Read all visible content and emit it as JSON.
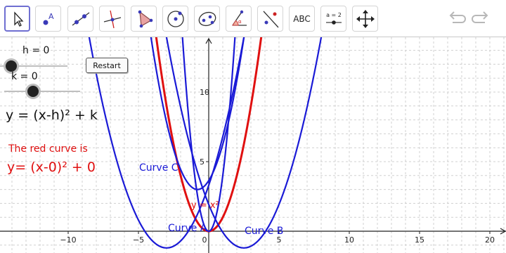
{
  "toolbar": {
    "tools": [
      {
        "name": "move-tool",
        "icon": "cursor-arrow-icon"
      },
      {
        "name": "point-tool",
        "icon": "point-a-icon"
      },
      {
        "name": "line-tool",
        "icon": "line-through-points-icon"
      },
      {
        "name": "perpendicular-line-tool",
        "icon": "perpendicular-line-icon"
      },
      {
        "name": "polygon-tool",
        "icon": "polygon-icon"
      },
      {
        "name": "circle-tool",
        "icon": "circle-center-point-icon"
      },
      {
        "name": "ellipse-tool",
        "icon": "ellipse-icon"
      },
      {
        "name": "angle-tool",
        "icon": "angle-icon"
      },
      {
        "name": "reflect-tool",
        "icon": "reflect-about-line-icon"
      },
      {
        "name": "text-tool",
        "icon": "text-icon",
        "label": "ABC"
      },
      {
        "name": "slider-tool",
        "icon": "slider-icon",
        "label": "a = 2"
      },
      {
        "name": "move-graphics-tool",
        "icon": "move-arrows-icon"
      }
    ],
    "undo_icon": "undo-icon",
    "redo_icon": "redo-icon"
  },
  "sliders": {
    "h": {
      "label": "h = 0",
      "value": 0
    },
    "k": {
      "label": "k = 0",
      "value": 0
    }
  },
  "restart_label": "Restart",
  "equation_text": "y = (x-h)² + k",
  "red_note": "The red curve is",
  "red_equation": "y= (x-0)² + 0",
  "curves": {
    "red_label": "y = x²",
    "curve_a": "Curve A",
    "curve_b": "Curve B",
    "curve_c": "Curve C"
  },
  "colors": {
    "red": "#e01010",
    "blue": "#1a1ad6",
    "grid": "#d0d0d0",
    "axis": "#222222",
    "selected": "#6f6fd1"
  },
  "chart_data": {
    "type": "line",
    "xlim": [
      -15,
      21
    ],
    "ylim": [
      -1.2,
      13.8
    ],
    "grid": true,
    "x_ticks": [
      -10,
      -5,
      0,
      5,
      10,
      15,
      20
    ],
    "x_tick_labels": [
      "−10",
      "−5",
      "0",
      "5",
      "10",
      "15",
      "20"
    ],
    "y_ticks": [
      5,
      10
    ],
    "y_tick_labels": [
      "5",
      "10"
    ],
    "series": [
      {
        "name": "y = x²",
        "color": "#e01010",
        "a": 1,
        "h": 0,
        "k": 0
      },
      {
        "name": "Curve A",
        "color": "#1a1ad6",
        "a": 0.5,
        "h": -3,
        "k": -1.2
      },
      {
        "name": "Curve B",
        "color": "#1a1ad6",
        "a": 0.5,
        "h": 2.5,
        "k": -1.2
      },
      {
        "name": "Curve C",
        "color": "#1a1ad6",
        "a": 1,
        "h": -0.8,
        "k": 3
      },
      {
        "name": "",
        "color": "#1a1ad6",
        "a": 4,
        "h": 0,
        "k": 0
      }
    ]
  }
}
